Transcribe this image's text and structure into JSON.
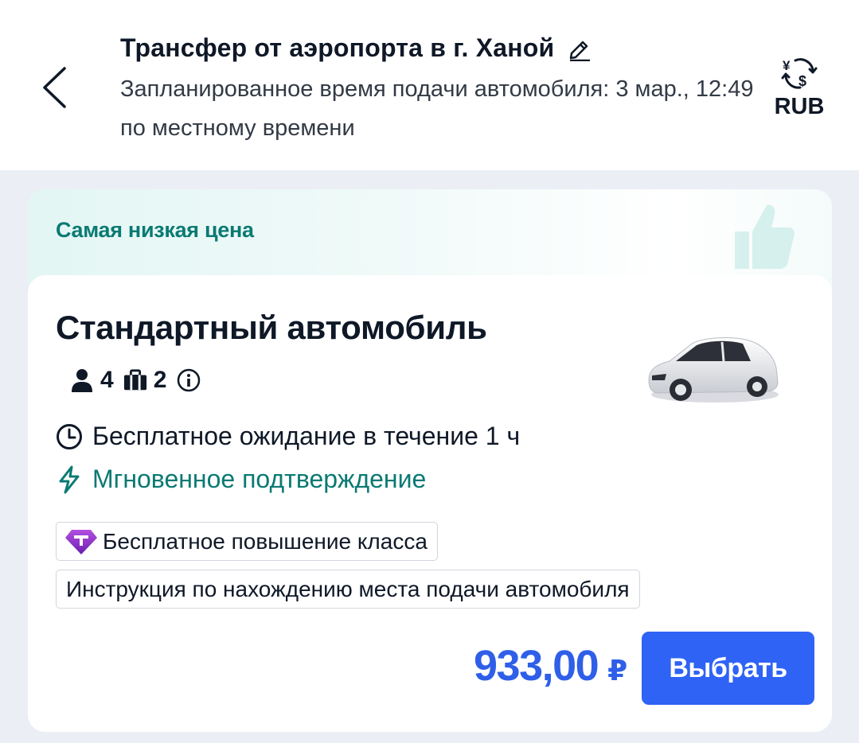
{
  "header": {
    "title": "Трансфер от аэропорта в г. Ханой",
    "subtitle": "Запланированное время подачи автомобиля: 3 мар., 12:49 по местному времени",
    "currency": "RUB",
    "icons": {
      "back": "chevron-left-icon",
      "edit": "edit-icon",
      "currency": "currency-exchange-icon"
    }
  },
  "offer": {
    "banner_label": "Самая низкая цена",
    "car_class": "Стандартный автомобиль",
    "passengers": "4",
    "luggage": "2",
    "features": {
      "free_wait": "Бесплатное ожидание в течение 1 ч",
      "instant_confirm": "Мгновенное подтверждение"
    },
    "tags": {
      "upgrade": "Бесплатное повышение класса",
      "instructions": "Инструкция по нахождению места подачи автомобиля"
    },
    "price": "933,00",
    "currency_symbol": "₽",
    "select_label": "Выбрать"
  },
  "colors": {
    "accent_blue": "#2f63f5",
    "teal": "#0a7a73",
    "background": "#ebeff5"
  }
}
